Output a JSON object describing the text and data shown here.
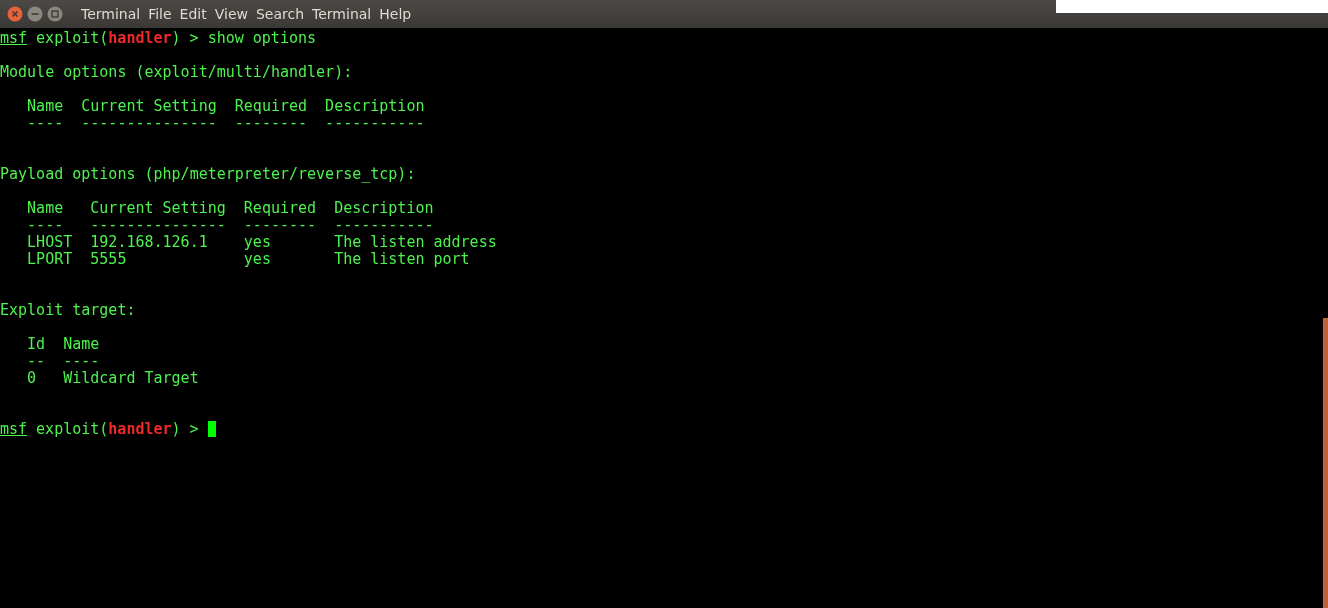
{
  "menu": [
    {
      "label": "Terminal"
    },
    {
      "label": "File"
    },
    {
      "label": "Edit"
    },
    {
      "label": "View"
    },
    {
      "label": "Search"
    },
    {
      "label": "Terminal"
    },
    {
      "label": "Help"
    }
  ],
  "lines": [
    {
      "kind": "prompt",
      "prompt": "msf",
      "context": "exploit(",
      "module": "handler",
      "close": ") >",
      "command": "show options"
    },
    {
      "kind": "blank"
    },
    {
      "kind": "text",
      "text": "Module options (exploit/multi/handler):"
    },
    {
      "kind": "blank"
    },
    {
      "kind": "text",
      "text": "   Name  Current Setting  Required  Description"
    },
    {
      "kind": "text",
      "text": "   ----  ---------------  --------  -----------"
    },
    {
      "kind": "blank"
    },
    {
      "kind": "blank"
    },
    {
      "kind": "text",
      "text": "Payload options (php/meterpreter/reverse_tcp):"
    },
    {
      "kind": "blank"
    },
    {
      "kind": "text",
      "text": "   Name   Current Setting  Required  Description"
    },
    {
      "kind": "text",
      "text": "   ----   ---------------  --------  -----------"
    },
    {
      "kind": "text",
      "text": "   LHOST  192.168.126.1    yes       The listen address"
    },
    {
      "kind": "text",
      "text": "   LPORT  5555             yes       The listen port"
    },
    {
      "kind": "blank"
    },
    {
      "kind": "blank"
    },
    {
      "kind": "text",
      "text": "Exploit target:"
    },
    {
      "kind": "blank"
    },
    {
      "kind": "text",
      "text": "   Id  Name"
    },
    {
      "kind": "text",
      "text": "   --  ----"
    },
    {
      "kind": "text",
      "text": "   0   Wildcard Target"
    },
    {
      "kind": "blank"
    },
    {
      "kind": "blank"
    },
    {
      "kind": "prompt",
      "prompt": "msf",
      "context": "exploit(",
      "module": "handler",
      "close": ") >",
      "cursor": true
    }
  ]
}
